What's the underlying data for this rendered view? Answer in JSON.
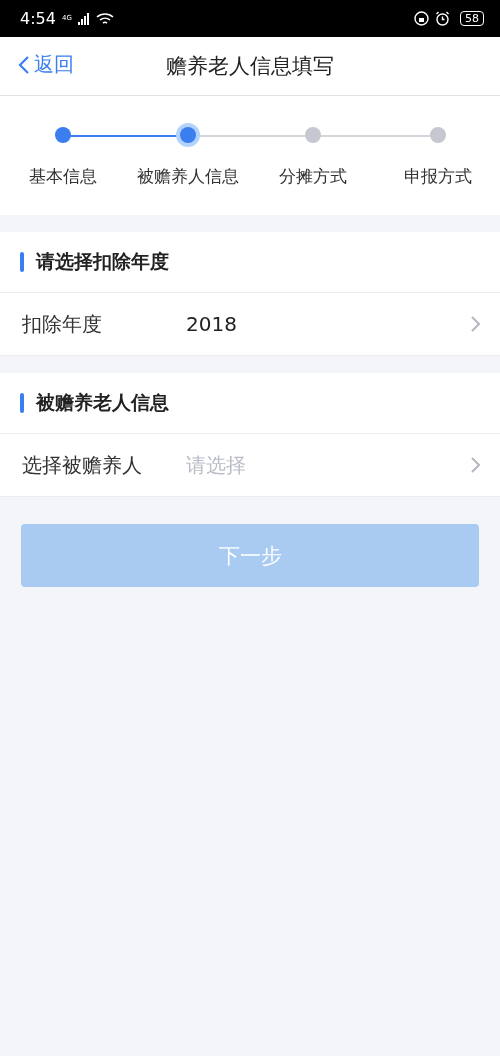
{
  "status_bar": {
    "time": "4:54",
    "network": "4G",
    "battery": "58"
  },
  "header": {
    "back": "返回",
    "title": "赡养老人信息填写"
  },
  "steps": [
    {
      "label": "基本信息",
      "completed": true,
      "selected": false
    },
    {
      "label": "被赡养人信息",
      "completed": false,
      "selected": true
    },
    {
      "label": "分摊方式",
      "completed": false,
      "selected": false
    },
    {
      "label": "申报方式",
      "completed": false,
      "selected": false
    }
  ],
  "sections": [
    {
      "title": "请选择扣除年度",
      "row": {
        "label": "扣除年度",
        "value": "2018"
      }
    },
    {
      "title": "被赡养老人信息",
      "row": {
        "label": "选择被赡养人",
        "placeholder": "请选择"
      }
    }
  ],
  "next_button": {
    "label": "下一步",
    "disabled": true
  }
}
